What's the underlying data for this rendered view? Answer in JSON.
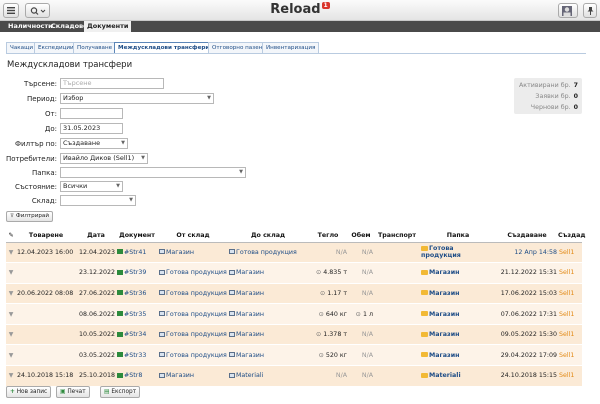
{
  "app": {
    "title": "Reload",
    "badge": "1"
  },
  "menu": [
    "Наличности",
    "Складове",
    "Документи"
  ],
  "tabs": [
    "Чакащи",
    "Експедиции",
    "Получаване",
    "Междускладови трансфери",
    "Отговорно пазене",
    "Инвентаризация"
  ],
  "page_title": "Междускладови трансфери",
  "filters": {
    "search_label": "Търсене:",
    "search_placeholder": "Търсене",
    "period_label": "Период:",
    "period_value": "Избор",
    "from_label": "От:",
    "from_value": "",
    "to_label": "До:",
    "to_value": "31.05.2023",
    "filter_by_label": "Филтър по:",
    "filter_by_value": "Създаване",
    "users_label": "Потребители:",
    "users_value": "Ивайло Диков (Sell1)",
    "folder_label": "Папка:",
    "folder_value": "",
    "state_label": "Състояние:",
    "state_value": "Всички",
    "warehouse_label": "Склад:",
    "warehouse_value": "",
    "filter_button": "Филтрирай"
  },
  "stats": [
    {
      "label": "Активирани бр.",
      "value": "7"
    },
    {
      "label": "Заявки бр.",
      "value": "0"
    },
    {
      "label": "Чернови бр.",
      "value": "0"
    }
  ],
  "table": {
    "headers": [
      "Товарене",
      "Дата",
      "Документ",
      "От склад",
      "До склад",
      "Тегло",
      "Обем",
      "Транспорт",
      "Папка",
      "Създаване",
      "Създад"
    ],
    "rows": [
      {
        "loading": "12.04.2023 16:00",
        "date": "12.04.2023",
        "doc": "#Str41",
        "from": "Магазин",
        "to": "Готова продукция",
        "weight": "N/A",
        "volume": "N/A",
        "transport": "",
        "folder": "Готова продукция",
        "created": "12 Апр 14:58",
        "creator": "Sell1"
      },
      {
        "loading": "",
        "date": "23.12.2022",
        "doc": "#Str39",
        "from": "Готова продукция",
        "to": "Магазин",
        "weight": "4.835 т",
        "volume": "N/A",
        "transport": "",
        "folder": "Магазин",
        "created": "21.12.2022 15:31",
        "creator": "Sell1"
      },
      {
        "loading": "20.06.2022 08:08",
        "date": "27.06.2022",
        "doc": "#Str36",
        "from": "Готова продукция",
        "to": "Магазин",
        "weight": "1.17 т",
        "volume": "N/A",
        "transport": "",
        "folder": "Магазин",
        "created": "17.06.2022 15:03",
        "creator": "Sell1"
      },
      {
        "loading": "",
        "date": "08.06.2022",
        "doc": "#Str35",
        "from": "Готова продукция",
        "to": "Магазин",
        "weight": "640 кг",
        "volume": "1 л",
        "transport": "",
        "folder": "Магазин",
        "created": "07.06.2022 17:31",
        "creator": "Sell1"
      },
      {
        "loading": "",
        "date": "10.05.2022",
        "doc": "#Str34",
        "from": "Готова продукция",
        "to": "Магазин",
        "weight": "1.378 т",
        "volume": "N/A",
        "transport": "",
        "folder": "Магазин",
        "created": "09.05.2022 15:30",
        "creator": "Sell1"
      },
      {
        "loading": "",
        "date": "03.05.2022",
        "doc": "#Str33",
        "from": "Готова продукция",
        "to": "Магазин",
        "weight": "520 кг",
        "volume": "N/A",
        "transport": "",
        "folder": "Магазин",
        "created": "29.04.2022 17:09",
        "creator": "Sell1"
      },
      {
        "loading": "24.10.2018 15:18",
        "date": "25.10.2018",
        "doc": "#Str8",
        "from": "Магазин",
        "to": "Materiali",
        "weight": "N/A",
        "volume": "N/A",
        "transport": "",
        "folder": "Materiali",
        "created": "24.10.2018 15:15",
        "creator": "Sell1"
      }
    ]
  },
  "buttons": {
    "new": "Нов запис",
    "print": "Печат",
    "export": "Експорт"
  }
}
